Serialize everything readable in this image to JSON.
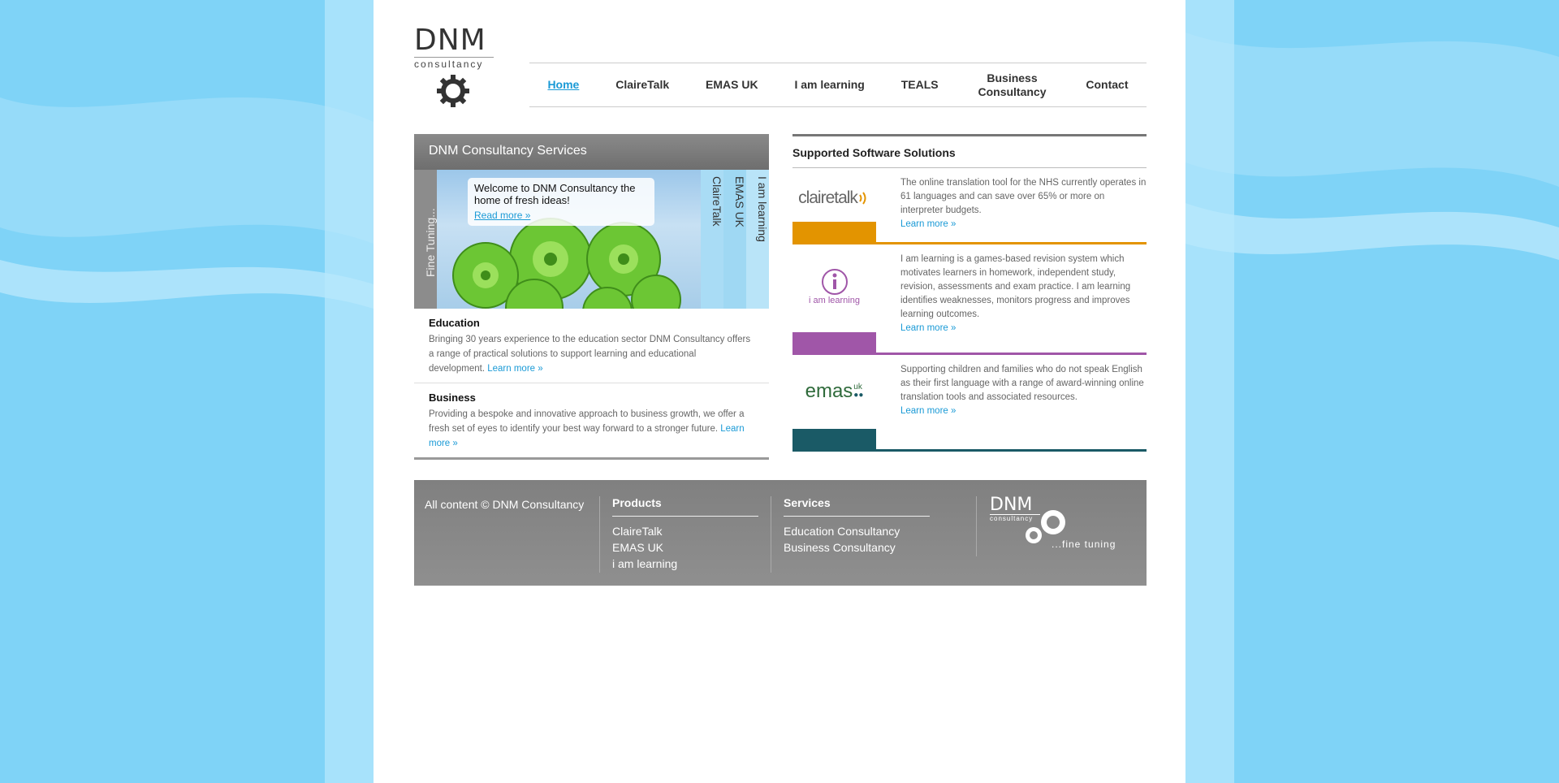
{
  "brand": {
    "name": "DNM",
    "subtitle": "consultancy"
  },
  "nav": [
    {
      "label": "Home"
    },
    {
      "label": "ClaireTalk"
    },
    {
      "label": "EMAS UK"
    },
    {
      "label": "I am learning"
    },
    {
      "label": "TEALS"
    },
    {
      "label": "Business Consultancy"
    },
    {
      "label": "Contact"
    }
  ],
  "services": {
    "title": "DNM Consultancy Services",
    "slider": {
      "left_tab": "Fine Tuning...",
      "tabs": [
        "ClaireTalk",
        "EMAS UK",
        "I am learning"
      ],
      "welcome": "Welcome to DNM Consultancy the home of fresh ideas!",
      "read_more": "Read more »"
    },
    "items": [
      {
        "title": "Education",
        "text": "Bringing 30 years experience to the education sector DNM Consultancy offers a range of practical solutions to support learning and educational development.",
        "link": "Learn more »"
      },
      {
        "title": "Business",
        "text": "Providing a bespoke and innovative approach to business growth, we offer a fresh set of eyes to identify your best way forward to a stronger future.",
        "link": "Learn more  »"
      }
    ]
  },
  "supported": {
    "title": "Supported Software Solutions",
    "items": [
      {
        "logo_text": "clairetalk",
        "text": "The online translation tool for the NHS currently operates in 61 languages and can save over 65% or more on interpreter budgets.",
        "link": "Learn more »",
        "color": "#e39400"
      },
      {
        "logo_text": "i am learning",
        "text": "I am learning is a games-based revision system which motivates learners in homework, independent study, revision, assessments and exam practice. I am learning identifies weaknesses, monitors progress and improves learning outcomes.",
        "link": "Learn more »",
        "color": "#a056a8"
      },
      {
        "logo_text": "emas",
        "logo_super": "uk",
        "text": "Supporting children and families who do not speak English as their first language with a range of award-winning online translation tools and associated resources.",
        "link": "Learn more »",
        "color": "#1a5a66"
      }
    ]
  },
  "footer": {
    "copyright": "All content © DNM Consultancy",
    "products": {
      "title": "Products",
      "links": [
        "ClaireTalk",
        "EMAS UK",
        "i am learning"
      ]
    },
    "services": {
      "title": "Services",
      "links": [
        "Education Consultancy",
        "Business Consultancy"
      ]
    },
    "logo_name": "DNM",
    "logo_sub": "consultancy",
    "tagline": "...fine tuning"
  }
}
